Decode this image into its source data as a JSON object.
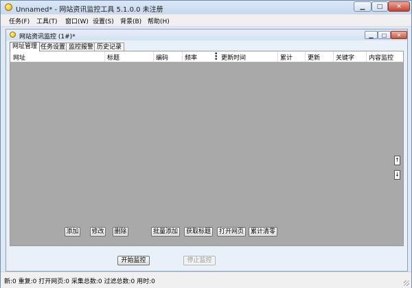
{
  "window": {
    "title": "Unnamed* - 网站资讯监控工具 5.1.0.0 未注册",
    "controls": {
      "minimize": "▁",
      "maximize": "□",
      "close": "✕"
    }
  },
  "menu": [
    "任务(F)",
    "工具(T)",
    "窗口(W)",
    "设置(S)",
    "背景(B)",
    "帮助(H)"
  ],
  "child": {
    "title": "网站资讯监控 (1#)*",
    "controls": {
      "minimize": "▁",
      "maximize": "□",
      "close": "✕"
    }
  },
  "tabs": [
    "网址管理",
    "任务设置",
    "监控报警",
    "历史记录"
  ],
  "active_tab": "网址管理",
  "columns": [
    "网址",
    "标题",
    "编码",
    "频率",
    "更新时间",
    "累计",
    "更新",
    "关键字",
    "内容监控"
  ],
  "side_buttons": {
    "up": "↑",
    "down": "↓"
  },
  "action_buttons": [
    "添加",
    "修改",
    "删除",
    "批量添加",
    "获取标题",
    "打开网页",
    "累计清零"
  ],
  "monitor_buttons": {
    "start": "开始监控",
    "stop": "停止监控"
  },
  "status": "新:0  重复:0  打开网页:0  采集总数:0  过滤总数:0  用时:0"
}
